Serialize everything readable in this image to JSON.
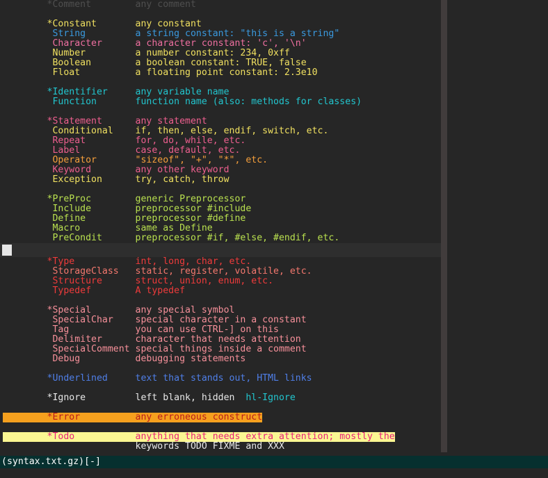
{
  "window": {
    "app": "vim",
    "background": "#262626",
    "statusline": {
      "text": "(syntax.txt.gz)[-]",
      "bg": "#06302f",
      "fg": "#ffffff"
    },
    "cmdline": {
      "text": ""
    }
  },
  "scrollbars": {
    "vertical": {
      "track_color": "#262626",
      "thumb_color": "#413c3c"
    },
    "horizontal": {
      "track_color": "#2e2e2e",
      "thumb_color": "#e6e6e6"
    }
  },
  "palette": {
    "comment": "#4f4f4f",
    "constant": "#f0e060",
    "string": "#3a9ae0",
    "character": "#ee6fa0",
    "number": "#f0e060",
    "boolean": "#f0e060",
    "float": "#f0e060",
    "identifier": "#22c6cf",
    "function": "#22c6cf",
    "statement": "#ee5f8f",
    "conditional": "#f0e060",
    "repeat": "#ee5f8f",
    "label": "#ee5f8f",
    "operator": "#f59f3b",
    "keyword": "#ee5f8f",
    "exception": "#f0e060",
    "preproc": "#b9e04f",
    "type": "#ef3b3b",
    "storageclass": "#f4786e",
    "structure": "#ef3b3b",
    "typedef": "#ef3b3b",
    "special": "#f7909a",
    "underlined": "#4f7fe8",
    "ignore": "#e8e8e8",
    "link": "#22c6cf",
    "error_fg": "#b81c1c",
    "error_bg": "#f5a01e",
    "todo_fg": "#e8217a",
    "todo_bg": "#fbf792"
  },
  "lines": [
    {
      "id": "comment",
      "segments": [
        {
          "t": "        *Comment        any comment",
          "c": "comment"
        }
      ]
    },
    {
      "id": "blank-1",
      "segments": [
        {
          "t": "",
          "c": "ignore"
        }
      ]
    },
    {
      "id": "constant",
      "segments": [
        {
          "t": "        *Constant       any constant",
          "c": "constant"
        }
      ]
    },
    {
      "id": "string",
      "segments": [
        {
          "t": "         String         a string constant: \"this is a string\"",
          "c": "string"
        }
      ]
    },
    {
      "id": "character",
      "segments": [
        {
          "t": "         Character      a character constant: 'c', '\\n'",
          "c": "character"
        }
      ]
    },
    {
      "id": "number",
      "segments": [
        {
          "t": "         Number         a number constant: 234, 0xff",
          "c": "number"
        }
      ]
    },
    {
      "id": "boolean",
      "segments": [
        {
          "t": "         Boolean        a boolean constant: TRUE, false",
          "c": "boolean"
        }
      ]
    },
    {
      "id": "float",
      "segments": [
        {
          "t": "         Float          a floating point constant: 2.3e10",
          "c": "float"
        }
      ]
    },
    {
      "id": "blank-2",
      "segments": [
        {
          "t": "",
          "c": "ignore"
        }
      ]
    },
    {
      "id": "identifier",
      "segments": [
        {
          "t": "        *Identifier     any variable name",
          "c": "identifier"
        }
      ]
    },
    {
      "id": "function",
      "segments": [
        {
          "t": "         Function       function name (also: methods for classes)",
          "c": "function"
        }
      ]
    },
    {
      "id": "blank-3",
      "segments": [
        {
          "t": "",
          "c": "ignore"
        }
      ]
    },
    {
      "id": "statement",
      "segments": [
        {
          "t": "        *Statement      any statement",
          "c": "statement"
        }
      ]
    },
    {
      "id": "conditional",
      "segments": [
        {
          "t": "         Conditional    if, then, else, endif, switch, etc.",
          "c": "conditional"
        }
      ]
    },
    {
      "id": "repeat",
      "segments": [
        {
          "t": "         Repeat         for, do, while, etc.",
          "c": "repeat"
        }
      ]
    },
    {
      "id": "label",
      "segments": [
        {
          "t": "         Label          case, default, etc.",
          "c": "label"
        }
      ]
    },
    {
      "id": "operator",
      "segments": [
        {
          "t": "         Operator       \"sizeof\", \"+\", \"*\", etc.",
          "c": "operator"
        }
      ]
    },
    {
      "id": "keyword",
      "segments": [
        {
          "t": "         Keyword        any other keyword",
          "c": "keyword"
        }
      ]
    },
    {
      "id": "exception",
      "segments": [
        {
          "t": "         Exception      try, catch, throw",
          "c": "exception"
        }
      ]
    },
    {
      "id": "blank-4",
      "segments": [
        {
          "t": "",
          "c": "ignore"
        }
      ]
    },
    {
      "id": "preproc",
      "segments": [
        {
          "t": "        *PreProc        generic Preprocessor",
          "c": "preproc"
        }
      ]
    },
    {
      "id": "include",
      "segments": [
        {
          "t": "         Include        preprocessor #include",
          "c": "preproc"
        }
      ]
    },
    {
      "id": "define",
      "segments": [
        {
          "t": "         Define         preprocessor #define",
          "c": "preproc"
        }
      ]
    },
    {
      "id": "macro",
      "segments": [
        {
          "t": "         Macro          same as Define",
          "c": "preproc"
        }
      ]
    },
    {
      "id": "precondit",
      "segments": [
        {
          "t": "         PreCondit      preprocessor #if, #else, #endif, etc.",
          "c": "preproc"
        }
      ]
    },
    {
      "id": "hscroll-gap",
      "segments": [
        {
          "t": "",
          "c": "ignore"
        }
      ],
      "spacer": true
    },
    {
      "id": "type",
      "segments": [
        {
          "t": "        *Type           int, long, char, etc.",
          "c": "type"
        }
      ]
    },
    {
      "id": "storageclass",
      "segments": [
        {
          "t": "         StorageClass   static, register, volatile, etc.",
          "c": "storageclass"
        }
      ]
    },
    {
      "id": "structure",
      "segments": [
        {
          "t": "         Structure      struct, union, enum, etc.",
          "c": "structure"
        }
      ]
    },
    {
      "id": "typedef",
      "segments": [
        {
          "t": "         Typedef        A typedef",
          "c": "typedef"
        }
      ]
    },
    {
      "id": "blank-5",
      "segments": [
        {
          "t": "",
          "c": "ignore"
        }
      ]
    },
    {
      "id": "special",
      "segments": [
        {
          "t": "        *Special        any special symbol",
          "c": "special"
        }
      ]
    },
    {
      "id": "specialchar",
      "segments": [
        {
          "t": "         SpecialChar    special character in a constant",
          "c": "special"
        }
      ]
    },
    {
      "id": "tag",
      "segments": [
        {
          "t": "         Tag            you can use CTRL-] on this",
          "c": "special"
        }
      ]
    },
    {
      "id": "delimiter",
      "segments": [
        {
          "t": "         Delimiter      character that needs attention",
          "c": "special"
        }
      ]
    },
    {
      "id": "specialcomment",
      "segments": [
        {
          "t": "         SpecialComment special things inside a comment",
          "c": "special"
        }
      ]
    },
    {
      "id": "debug",
      "segments": [
        {
          "t": "         Debug          debugging statements",
          "c": "special"
        }
      ]
    },
    {
      "id": "blank-6",
      "segments": [
        {
          "t": "",
          "c": "ignore"
        }
      ]
    },
    {
      "id": "underlined",
      "segments": [
        {
          "t": "        *Underlined     text that stands out, HTML links",
          "c": "underlined"
        }
      ]
    },
    {
      "id": "blank-7",
      "segments": [
        {
          "t": "",
          "c": "ignore"
        }
      ]
    },
    {
      "id": "ignore",
      "segments": [
        {
          "t": "        *Ignore         left blank, hidden  ",
          "c": "ignore"
        },
        {
          "t": "hl-Ignore",
          "c": "link"
        }
      ]
    },
    {
      "id": "blank-8",
      "segments": [
        {
          "t": "",
          "c": "ignore"
        }
      ]
    },
    {
      "id": "error",
      "segments": [
        {
          "t": "        *Error          any erroneous construct",
          "c": "error_fg",
          "bg": "error_bg"
        }
      ]
    },
    {
      "id": "blank-9",
      "segments": [
        {
          "t": "",
          "c": "ignore"
        }
      ]
    },
    {
      "id": "todo",
      "segments": [
        {
          "t": "        *Todo           anything that needs extra attention; mostly the",
          "c": "todo_fg",
          "bg": "todo_bg"
        }
      ]
    },
    {
      "id": "todo-cont",
      "segments": [
        {
          "t": "                        keywords TODO FIXME and XXX",
          "c": "ignore"
        }
      ]
    }
  ]
}
